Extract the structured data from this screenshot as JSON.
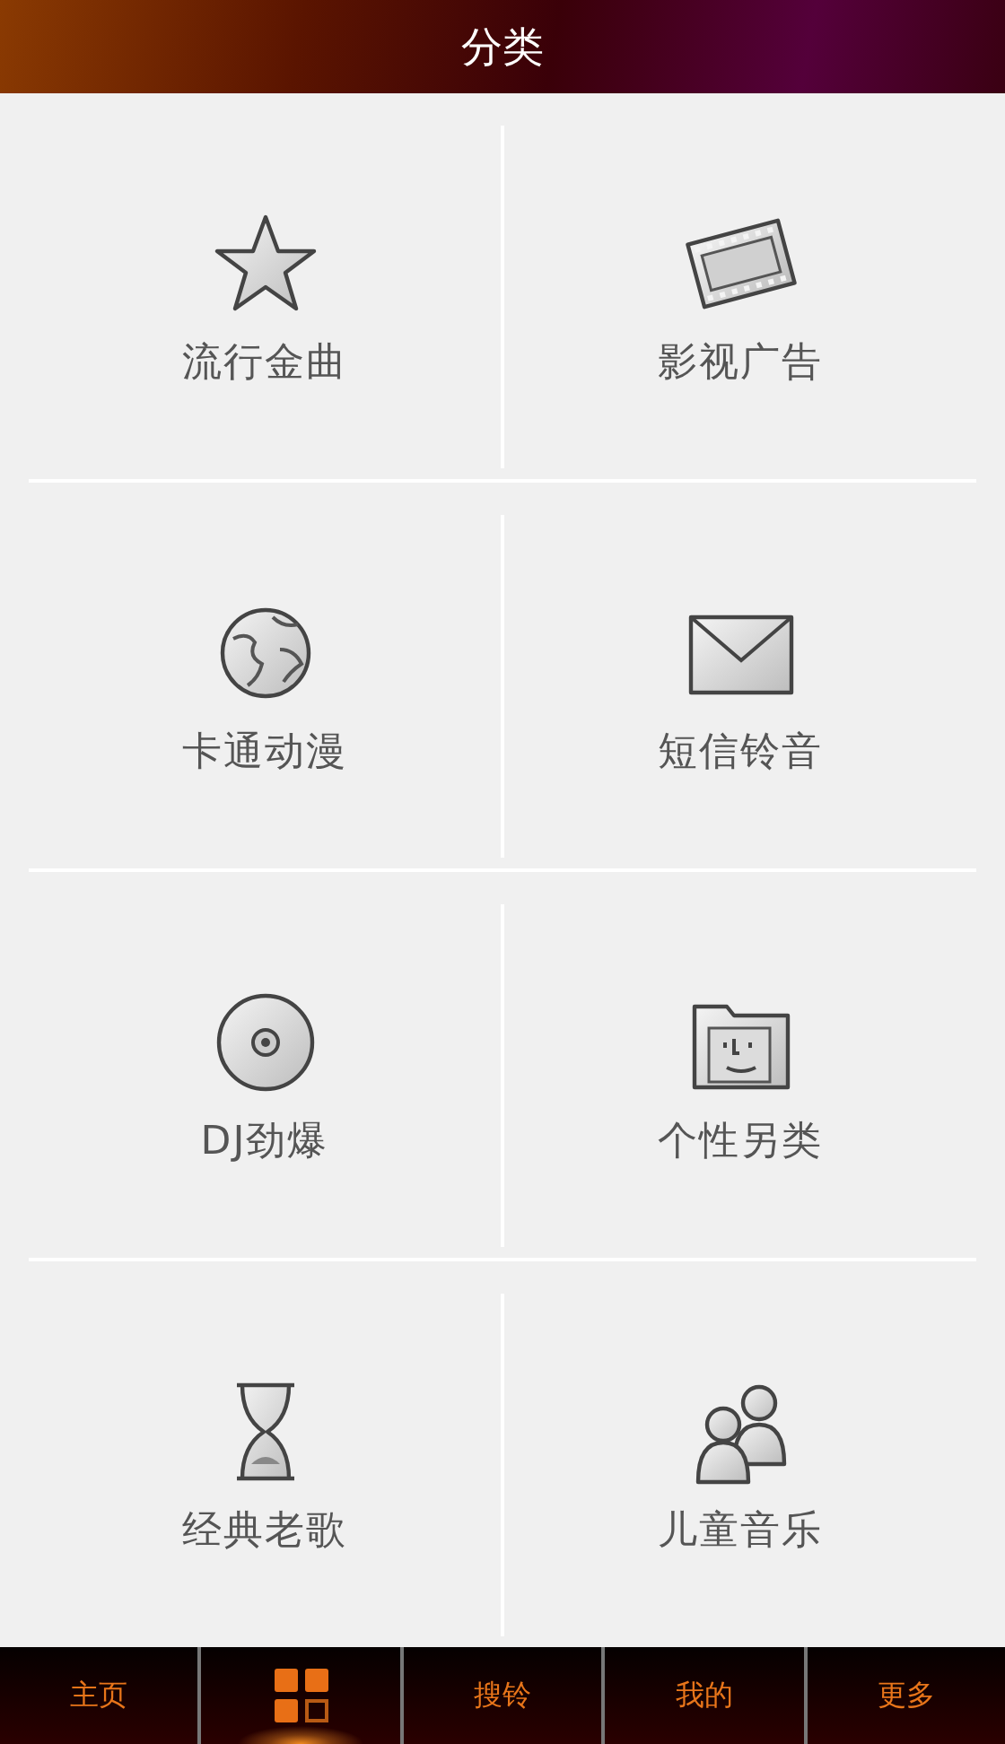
{
  "header": {
    "title": "分类"
  },
  "categories": [
    {
      "label": "流行金曲",
      "kind": "star"
    },
    {
      "label": "影视广告",
      "kind": "film"
    },
    {
      "label": "卡通动漫",
      "kind": "globe"
    },
    {
      "label": "短信铃音",
      "kind": "envelope"
    },
    {
      "label": "DJ劲爆",
      "kind": "disc"
    },
    {
      "label": "个性另类",
      "kind": "folder"
    },
    {
      "label": "经典老歌",
      "kind": "hourglass"
    },
    {
      "label": "儿童音乐",
      "kind": "people"
    }
  ],
  "tab_bar": [
    {
      "kind": "text",
      "label": "主页",
      "selected": false
    },
    {
      "kind": "grid",
      "selected": true
    },
    {
      "kind": "text",
      "label": "搜铃",
      "selected": false
    },
    {
      "kind": "text",
      "label": "我的",
      "selected": false
    },
    {
      "kind": "text",
      "label": "更多",
      "selected": false
    }
  ]
}
